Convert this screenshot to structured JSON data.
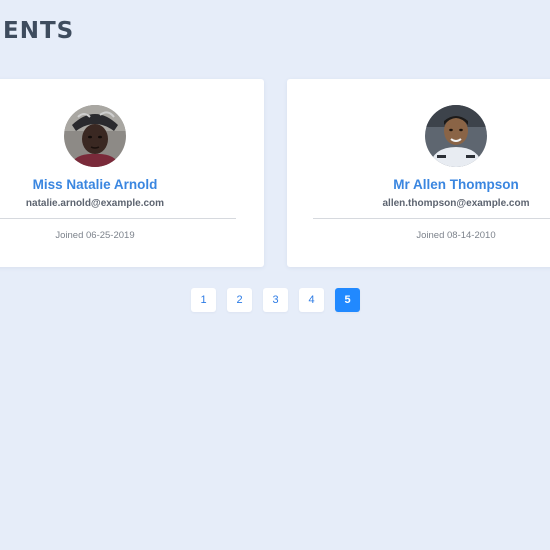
{
  "header": {
    "title": "ENTS"
  },
  "cards": [
    {
      "name": "Miss Natalie Arnold",
      "email": "natalie.arnold@example.com",
      "joined": "Joined 06-25-2019"
    },
    {
      "name": "Mr Allen Thompson",
      "email": "allen.thompson@example.com",
      "joined": "Joined 08-14-2010"
    }
  ],
  "pagination": {
    "pages": [
      "1",
      "2",
      "3",
      "4",
      "5"
    ],
    "current": "5"
  },
  "colors": {
    "background": "#e6edf9",
    "accent": "#2189ff",
    "name_text": "#3a86e0",
    "title_text": "#3e4c5e"
  }
}
